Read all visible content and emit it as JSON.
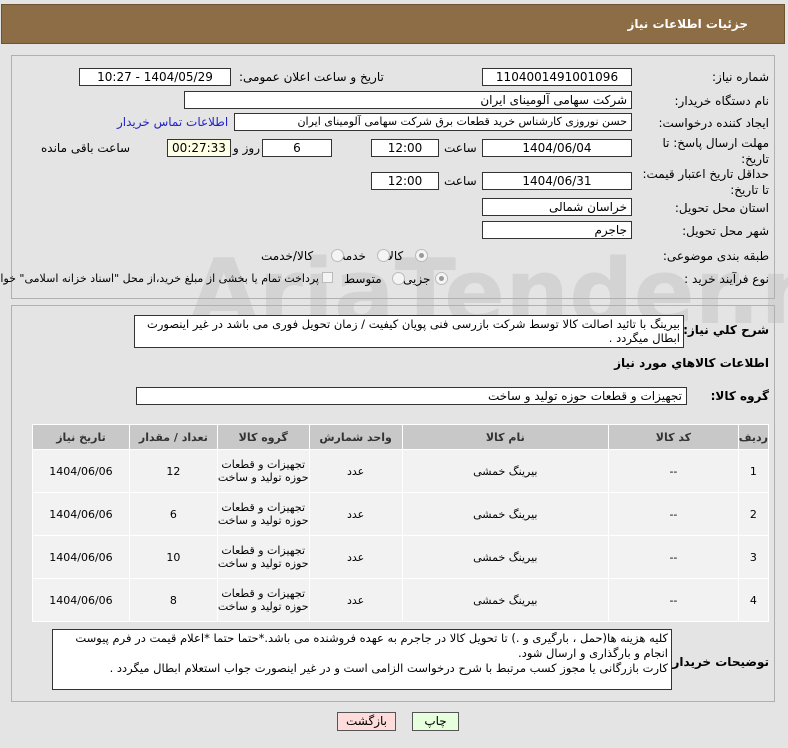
{
  "header": {
    "title": "جزئیات اطلاعات نیاز"
  },
  "form": {
    "need_number_label": "شماره نیاز:",
    "need_number": "1104001491001096",
    "announce_label": "تاریخ و ساعت اعلان عمومی:",
    "announce_value": "1404/05/29 - 10:27",
    "buyer_org_label": "نام دستگاه خریدار:",
    "buyer_org": "شرکت سهامی آلومینای ایران",
    "creator_label": "ایجاد کننده درخواست:",
    "creator": "حسن نوروزی کارشناس خرید قطعات برق شرکت سهامی آلومینای ایران",
    "contact_link": "اطلاعات تماس خریدار",
    "deadline_label": "مهلت ارسال پاسخ: تا تاریخ:",
    "deadline_date": "1404/06/04",
    "time_label": "ساعت",
    "deadline_time": "12:00",
    "days": "6",
    "days_label": "روز و",
    "remaining": "00:27:33",
    "remaining_label": "ساعت باقی مانده",
    "validity_label": "حداقل تاریخ اعتبار قیمت: تا تاریخ:",
    "validity_date": "1404/06/31",
    "validity_time": "12:00",
    "province_label": "استان محل تحویل:",
    "province": "خراسان شمالی",
    "city_label": "شهر محل تحویل:",
    "city": "جاجرم",
    "category_label": "طبقه بندی موضوعی:",
    "category_options": [
      "کالا",
      "خدمت",
      "کالا/خدمت"
    ],
    "process_label": "نوع فرآیند خرید :",
    "process_options": [
      "جزیی",
      "متوسط"
    ],
    "treasury_note": "پرداخت تمام یا بخشی از مبلغ خرید،از محل \"اسناد خزانه اسلامی\" خواهد بود."
  },
  "details": {
    "summary_label": "شرح کلي نیاز:",
    "summary": "بیرینگ با تائید اصالت کالا توسط شرکت بازرسی فنی پویان کیفیت / زمان تحویل فوری می باشد در غیر اینصورت ابطال میگردد .",
    "goods_title": "اطلاعات کالاهاي مورد نیاز",
    "group_label": "گروه کالا:",
    "group": "تجهیزات و قطعات حوزه تولید و ساخت",
    "columns": [
      "ردیف",
      "کد کالا",
      "نام کالا",
      "واحد شمارش",
      "گروه کالا",
      "تعداد / مقدار",
      "تاریخ نیاز"
    ],
    "rows": [
      {
        "idx": "1",
        "code": "--",
        "name": "بیرینگ خمشی",
        "unit": "عدد",
        "group": "تجهیزات و قطعات حوزه تولید و ساخت",
        "qty": "12",
        "date": "1404/06/06"
      },
      {
        "idx": "2",
        "code": "--",
        "name": "بیرینگ خمشی",
        "unit": "عدد",
        "group": "تجهیزات و قطعات حوزه تولید و ساخت",
        "qty": "6",
        "date": "1404/06/06"
      },
      {
        "idx": "3",
        "code": "--",
        "name": "بیرینگ خمشی",
        "unit": "عدد",
        "group": "تجهیزات و قطعات حوزه تولید و ساخت",
        "qty": "10",
        "date": "1404/06/06"
      },
      {
        "idx": "4",
        "code": "--",
        "name": "بیرینگ خمشی",
        "unit": "عدد",
        "group": "تجهیزات و قطعات حوزه تولید و ساخت",
        "qty": "8",
        "date": "1404/06/06"
      }
    ],
    "notes_label": "توضیحات خریدار:",
    "notes": "کلیه هزینه ها(حمل ، بارگیری و .) تا تحویل کالا در جاجرم به عهده فروشنده می باشد.*حتما حتما *اعلام قیمت در فرم پیوست انجام و بارگذاری و ارسال شود.\nکارت بازرگانی یا مجوز کسب مرتبط با شرح درخواست الزامی است و در غیر اینصورت جواب استعلام ابطال میگردد ."
  },
  "buttons": {
    "print": "چاپ",
    "back": "بازگشت"
  },
  "watermark": "AriaTender.neT"
}
